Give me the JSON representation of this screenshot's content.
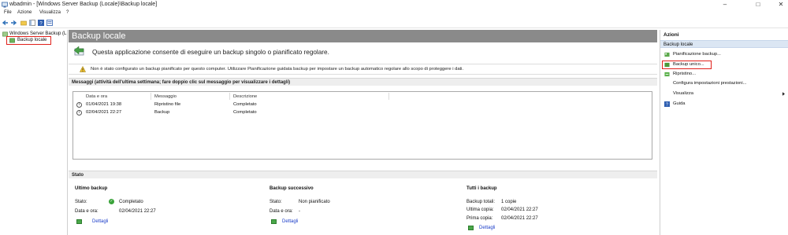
{
  "window": {
    "title": "wbadmin - [Windows Server Backup (Locale)\\Backup locale]",
    "minimize": "–",
    "maximize": "□",
    "close": "✕"
  },
  "menu": [
    "File",
    "Azione",
    "Visualizza",
    "?"
  ],
  "tree": {
    "root": "Windows Server Backup (L",
    "child": "Backup locale"
  },
  "main": {
    "header": "Backup locale",
    "intro": "Questa applicazione consente di eseguire un backup singolo o pianificato regolare.",
    "warning": "Non è stato configurato un backup pianificato per questo computer. Utilizzare Pianificazione guidata backup per impostare un backup automatico regolare allo scopo di proteggere i dati.",
    "messages_title": "Messaggi (attività dell'ultima settimana; fare doppio clic sul messaggio per visualizzare i dettagli)",
    "columns": [
      "Data e ora",
      "Messaggio",
      "Descrizione"
    ],
    "rows": [
      {
        "date": "01/04/2021 19:38",
        "message": "Ripristino file",
        "desc": "Completato"
      },
      {
        "date": "02/04/2021 22:27",
        "message": "Backup",
        "desc": "Completato"
      }
    ],
    "status_title": "Stato"
  },
  "status": {
    "last": {
      "title": "Ultimo backup",
      "state_label": "Stato:",
      "state_value": "Completato",
      "time_label": "Data e ora:",
      "time_value": "02/04/2021 22:27",
      "details": "Dettagli"
    },
    "next": {
      "title": "Backup successivo",
      "state_label": "Stato:",
      "state_value": "Non pianificato",
      "time_label": "Data e ora:",
      "time_value": "-",
      "details": "Dettagli"
    },
    "all": {
      "title": "Tutti i backup",
      "total_label": "Backup totali:",
      "total_value": "1 copie",
      "latest_label": "Ultima copia:",
      "latest_value": "02/04/2021 22:27",
      "first_label": "Prima copia:",
      "first_value": "02/04/2021 22:27",
      "details": "Dettagli"
    }
  },
  "actions": {
    "title": "Azioni",
    "section": "Backup locale",
    "items": [
      "Pianificazione backup...",
      "Backup unico...",
      "Ripristino...",
      "Configura impostazioni prestazioni...",
      "Visualizza",
      "Guida"
    ]
  },
  "colors": {
    "header_gray": "#8a8a8a",
    "highlight_red": "#e0201b",
    "link_blue": "#1a3cc8",
    "section_blue": "#dbe6f3"
  }
}
